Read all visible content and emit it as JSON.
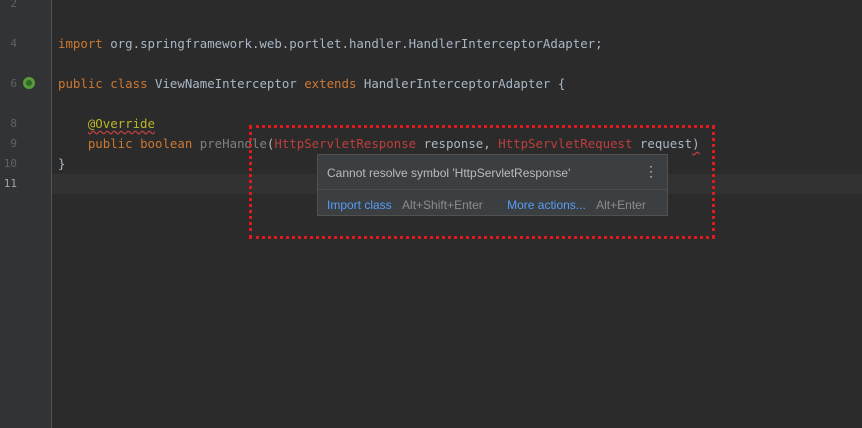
{
  "gutter": {
    "line_numbers": [
      "2",
      "4",
      "6",
      "8",
      "9",
      "10",
      "11"
    ]
  },
  "code": {
    "line4": {
      "kw": "import",
      "rest": " org.springframework.web.portlet.handler.HandlerInterceptorAdapter;"
    },
    "line6": {
      "kw1": "public",
      "kw2": "class",
      "name": " ViewNameInterceptor ",
      "kw3": "extends",
      "rest": " HandlerInterceptorAdapter {"
    },
    "line8": {
      "annotation": "@Override"
    },
    "line9": {
      "kw1": "public",
      "kw2": "boolean",
      "method": "preHandle",
      "open": "(",
      "type1": "HttpServletResponse",
      "arg1": " response, ",
      "type2": "HttpServletRequest",
      "arg2": " request",
      "close": ")"
    },
    "line10": {
      "text": "}"
    }
  },
  "popup": {
    "message": "Cannot resolve symbol 'HttpServletResponse'",
    "menu_icon": "kebab-menu-icon",
    "import_label": "Import class",
    "import_shortcut": "Alt+Shift+Enter",
    "more_label": "More actions...",
    "more_shortcut": "Alt+Enter"
  },
  "colors": {
    "background": "#2b2b2b",
    "keyword": "#cc7832",
    "error": "#bc3f3c",
    "annotation": "#bbb529",
    "link": "#589df6",
    "highlight_box": "#e0191f"
  }
}
